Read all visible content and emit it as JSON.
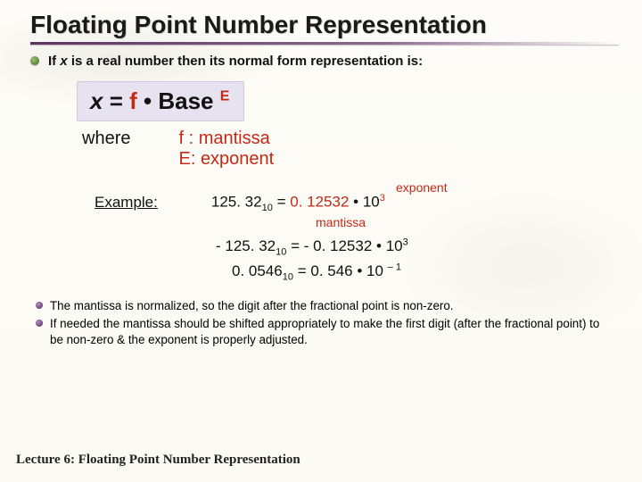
{
  "title": "Floating Point Number Representation",
  "intro_prefix": "If ",
  "intro_var": "x",
  "intro_suffix": " is a real number then its normal form representation is:",
  "formula": {
    "x": "x",
    "eq": " = ",
    "f": "f",
    "bullet": " • ",
    "base": "Base ",
    "E": "E"
  },
  "where_label": "where",
  "defs": {
    "mantissa": "f : mantissa",
    "exponent": "E: exponent"
  },
  "annot_exponent": "exponent",
  "example_label": "Example:",
  "eq1": {
    "lhs_num": "125. 32",
    "lhs_sub": "10",
    "eq": " = ",
    "mant": "0. 12532",
    "dot": " • ",
    "ten": "10",
    "sup": "3"
  },
  "annot_mantissa": "mantissa",
  "eq2": {
    "lhs_num": "- 125. 32",
    "lhs_sub": "10",
    "rhs": " = - 0. 12532 • 10",
    "sup": "3"
  },
  "eq3": {
    "lhs_num": "0. 0546",
    "lhs_sub": "10",
    "rhs": " =   0. 546 • 10 ",
    "sup": "– 1"
  },
  "notes": [
    "The mantissa is normalized, so the digit after the fractional point is non-zero.",
    "If needed the mantissa should be shifted appropriately to make the first digit (after the fractional point) to be non-zero & the exponent is properly adjusted."
  ],
  "footer": "Lecture 6: Floating Point Number Representation"
}
